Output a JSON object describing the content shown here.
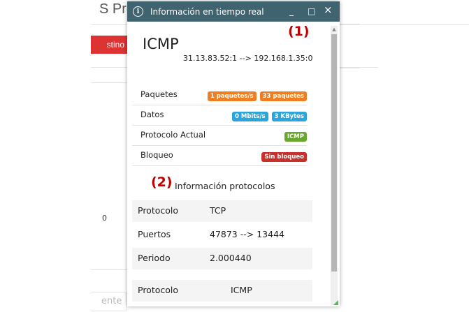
{
  "background": {
    "title": "Pro",
    "title_partial_prefix": "S",
    "red_button": "stino",
    "zero_text": "0",
    "bottom_text": "ente"
  },
  "dialog": {
    "title": "Información en tiempo real",
    "controls": {
      "minimize": "_",
      "maximize": "□",
      "close": "×"
    },
    "annotation_1": "(1)",
    "annotation_2": "(2)",
    "protocol_name": "ICMP",
    "flow": "31.13.83.52:1 --> 192.168.1.35:0",
    "stats": [
      {
        "label": "Paquetes",
        "badges": [
          {
            "text": "1 paquetes/s",
            "color": "#ef7d22"
          },
          {
            "text": "33 paquetes",
            "color": "#ef7d22"
          }
        ]
      },
      {
        "label": "Datos",
        "badges": [
          {
            "text": "0 Mbits/s",
            "color": "#2aa6dc"
          },
          {
            "text": "3 KBytes",
            "color": "#2aa6dc"
          }
        ]
      },
      {
        "label": "Protocolo Actual",
        "badges": [
          {
            "text": "ICMP",
            "color": "#6aa72e"
          }
        ]
      },
      {
        "label": "Bloqueo",
        "badges": [
          {
            "text": "Sin bloqueo",
            "color": "#c9302c"
          }
        ]
      }
    ],
    "section_title": "Información protocolos",
    "protocols_table": [
      {
        "key": "Protocolo",
        "value": "TCP"
      },
      {
        "key": "Puertos",
        "value": "47873 --> 13444"
      },
      {
        "key": "Periodo",
        "value": "2.000440"
      }
    ],
    "protocols_table_2": [
      {
        "key": "Protocolo",
        "value": "ICMP"
      }
    ]
  }
}
